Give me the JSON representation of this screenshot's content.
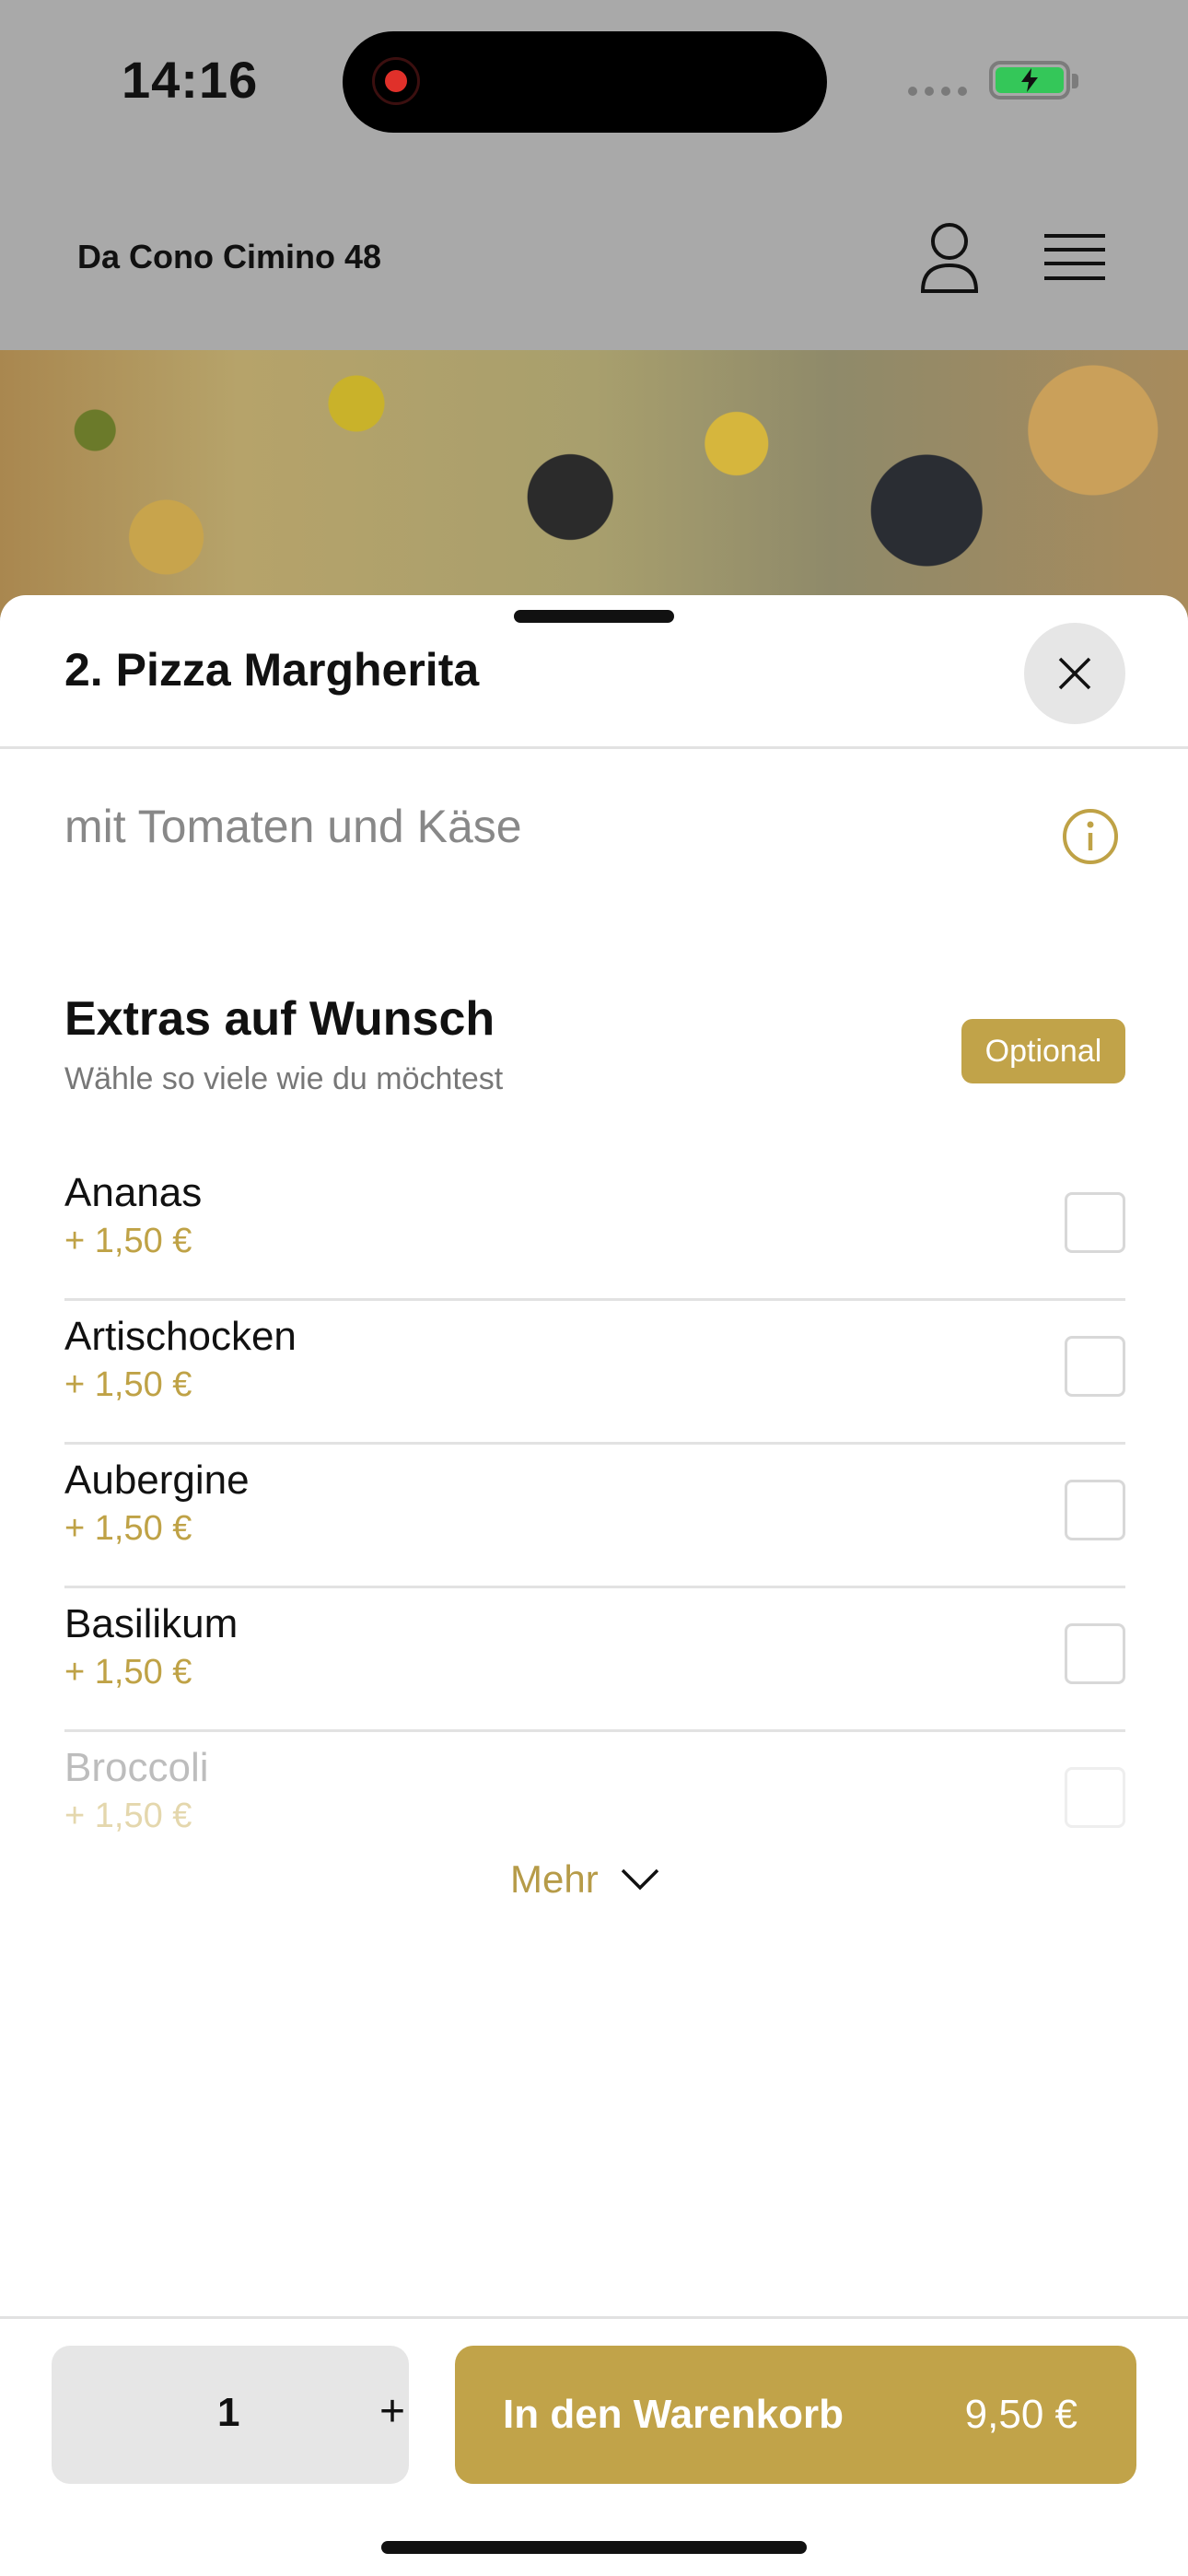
{
  "status": {
    "time": "14:16"
  },
  "header": {
    "restaurant": "Da Cono Cimino 48"
  },
  "product": {
    "title": "2. Pizza Margherita",
    "description": "mit Tomaten und Käse"
  },
  "extras": {
    "title": "Extras auf Wunsch",
    "subtitle": "Wähle so viele wie du möchtest",
    "badge": "Optional",
    "options": [
      {
        "name": "Ananas",
        "price": "+ 1,50 €"
      },
      {
        "name": "Artischocken",
        "price": "+ 1,50 €"
      },
      {
        "name": "Aubergine",
        "price": "+ 1,50 €"
      },
      {
        "name": "Basilikum",
        "price": "+ 1,50 €"
      },
      {
        "name": "Broccoli",
        "price": "+ 1,50 €"
      }
    ],
    "more_label": "Mehr"
  },
  "footer": {
    "quantity": "1",
    "plus": "+",
    "cart_label": "In den Warenkorb",
    "cart_price": "9,50 €"
  },
  "colors": {
    "accent": "#c1a349",
    "dim_overlay": "#a9a9a9"
  },
  "icons": [
    "record-icon",
    "battery-icon",
    "user-icon",
    "menu-icon",
    "close-icon",
    "info-icon",
    "chevron-down-icon"
  ]
}
